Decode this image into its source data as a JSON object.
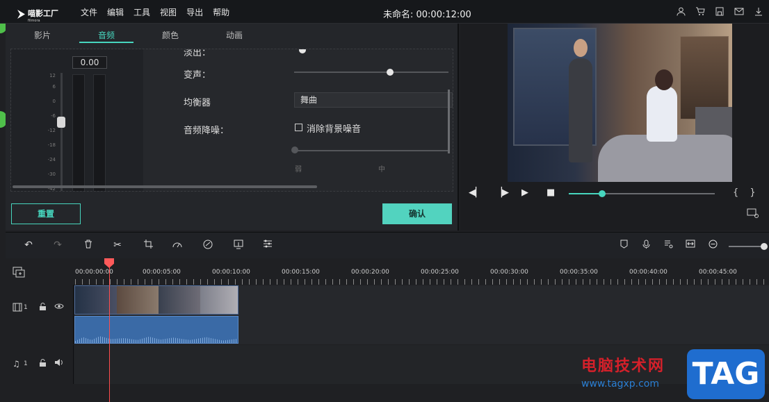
{
  "app": {
    "logo_name": "喵影工厂",
    "logo_sub": "filmora",
    "project_title": "未命名: 00:00:12:00"
  },
  "menu": [
    "文件",
    "编辑",
    "工具",
    "视图",
    "导出",
    "帮助"
  ],
  "top_icons": [
    "user-icon",
    "cart-icon",
    "save-icon",
    "mail-icon",
    "download-icon"
  ],
  "tabs": [
    {
      "label": "影片",
      "active": false
    },
    {
      "label": "音频",
      "active": true
    },
    {
      "label": "颜色",
      "active": false
    },
    {
      "label": "动画",
      "active": false
    }
  ],
  "audio": {
    "volume_value": "0.00",
    "scale": [
      "12",
      "6",
      "0",
      "-6",
      "-12",
      "-18",
      "-24",
      "-30",
      "-42"
    ],
    "fade_out_label": "淡出：",
    "voice_change_label": "变声：",
    "voice_change_level": 0.62,
    "equalizer_label": "均衡器",
    "equalizer_value": "舞曲",
    "denoise_label": "音频降噪：",
    "denoise_checkbox_label": "消除背景噪音",
    "denoise_checked": false,
    "weak_label": "弱",
    "mid_label": "中"
  },
  "buttons": {
    "reset": "重置",
    "ok": "确认"
  },
  "player": {
    "progress": 0.23,
    "braces": "{ }",
    "accent": "#47d6be"
  },
  "timeline": {
    "ticks": [
      "00:00:00:00",
      "00:00:05:00",
      "00:00:10:00",
      "00:00:15:00",
      "00:00:20:00",
      "00:00:25:00",
      "00:00:30:00",
      "00:00:35:00",
      "00:00:40:00",
      "00:00:45:00"
    ],
    "video_track_num": "1",
    "audio_track_num": "1"
  },
  "watermark": {
    "text": "电脑技术网",
    "url": "www.tagxp.com",
    "tag": "TAG"
  }
}
